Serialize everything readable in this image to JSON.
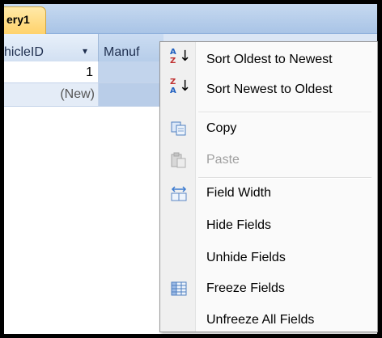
{
  "tab": {
    "label": "ery1"
  },
  "columns": {
    "vehicle_id": "hicleID",
    "vehicle_sort_arrow": "▾",
    "manufacturer": "Manuf"
  },
  "rows": [
    {
      "vehicle_id": "1"
    },
    {
      "vehicle_id": "(New)"
    }
  ],
  "context_menu": {
    "items": [
      {
        "label": "Sort Oldest to Newest",
        "icon": "sort-ascending-icon",
        "enabled": true
      },
      {
        "label": "Sort Newest to Oldest",
        "icon": "sort-descending-icon",
        "enabled": true
      },
      {
        "label": "Copy",
        "icon": "copy-icon",
        "enabled": true
      },
      {
        "label": "Paste",
        "icon": "paste-icon",
        "enabled": false
      },
      {
        "label": "Field Width",
        "icon": "field-width-icon",
        "enabled": true
      },
      {
        "label": "Hide Fields",
        "icon": "",
        "enabled": true
      },
      {
        "label": "Unhide Fields",
        "icon": "",
        "enabled": true
      },
      {
        "label": "Freeze Fields",
        "icon": "freeze-fields-icon",
        "enabled": true
      },
      {
        "label": "Unfreeze All Fields",
        "icon": "",
        "enabled": true
      }
    ]
  },
  "colors": {
    "tab_active": "#ffd26b",
    "header_bg": "#dbe6f5",
    "selected_column": "#b9cde8",
    "menu_bg": "#fafafa",
    "disabled_text": "#a0a0a0"
  }
}
